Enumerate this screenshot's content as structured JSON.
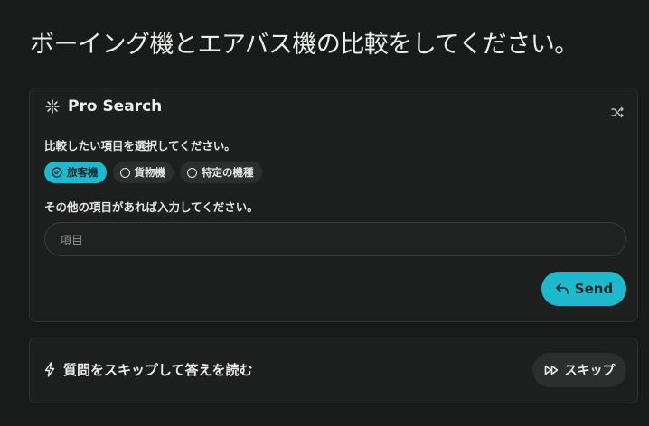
{
  "query": "ボーイング機とエアバス機の比較をしてください。",
  "pro_search": {
    "title": "Pro Search",
    "icon": "sparkle-icon",
    "shuffle_icon": "shuffle-icon",
    "question1": "比較したい項目を選択してください。",
    "options": [
      {
        "label": "旅客機",
        "selected": true
      },
      {
        "label": "貨物機",
        "selected": false
      },
      {
        "label": "特定の機種",
        "selected": false
      }
    ],
    "question2": "その他の項目があれば入力してください。",
    "input_placeholder": "項目",
    "send_label": "Send"
  },
  "skip": {
    "prompt": "質問をスキップして答えを読む",
    "button_label": "スキップ"
  },
  "colors": {
    "accent": "#20b8cd",
    "background": "#191a1a",
    "card": "#1e1f1f",
    "chip": "#2d2f2f"
  }
}
